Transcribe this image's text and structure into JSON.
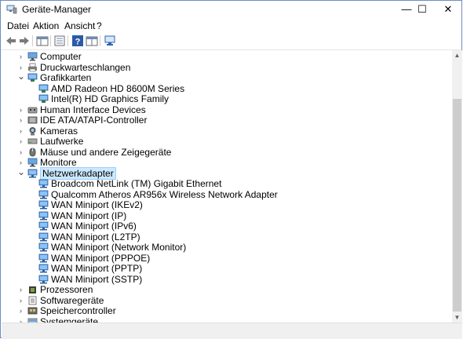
{
  "window": {
    "title": "Geräte-Manager"
  },
  "window_buttons": {
    "minimize": "—",
    "maximize": "☐",
    "close": "✕"
  },
  "menu": {
    "items": [
      "Datei",
      "Aktion",
      "Ansicht",
      "?"
    ]
  },
  "tree": {
    "items": [
      {
        "label": "Computer",
        "icon": "monitor-icon",
        "expanded": false,
        "level": 0
      },
      {
        "label": "Druckwarteschlangen",
        "icon": "printer-icon",
        "expanded": false,
        "level": 0
      },
      {
        "label": "Grafikkarten",
        "icon": "display-adapter-icon",
        "expanded": true,
        "level": 0
      },
      {
        "label": "AMD Radeon HD 8600M Series",
        "icon": "display-adapter-icon",
        "level": 1
      },
      {
        "label": "Intel(R) HD Graphics Family",
        "icon": "display-adapter-icon",
        "level": 1
      },
      {
        "label": "Human Interface Devices",
        "icon": "hid-icon",
        "expanded": false,
        "level": 0
      },
      {
        "label": "IDE ATA/ATAPI-Controller",
        "icon": "ide-controller-icon",
        "expanded": false,
        "level": 0
      },
      {
        "label": "Kameras",
        "icon": "camera-icon",
        "expanded": false,
        "level": 0
      },
      {
        "label": "Laufwerke",
        "icon": "drive-icon",
        "expanded": false,
        "level": 0
      },
      {
        "label": "Mäuse und andere Zeigegeräte",
        "icon": "mouse-icon",
        "expanded": false,
        "level": 0
      },
      {
        "label": "Monitore",
        "icon": "monitor-icon",
        "expanded": false,
        "level": 0
      },
      {
        "label": "Netzwerkadapter",
        "icon": "network-adapter-icon",
        "expanded": true,
        "selected": true,
        "level": 0
      },
      {
        "label": "Broadcom NetLink (TM) Gigabit Ethernet",
        "icon": "network-adapter-icon",
        "level": 1
      },
      {
        "label": "Qualcomm Atheros AR956x Wireless Network Adapter",
        "icon": "network-adapter-icon",
        "level": 1
      },
      {
        "label": "WAN Miniport (IKEv2)",
        "icon": "network-adapter-icon",
        "level": 1
      },
      {
        "label": "WAN Miniport (IP)",
        "icon": "network-adapter-icon",
        "level": 1
      },
      {
        "label": "WAN Miniport (IPv6)",
        "icon": "network-adapter-icon",
        "level": 1
      },
      {
        "label": "WAN Miniport (L2TP)",
        "icon": "network-adapter-icon",
        "level": 1
      },
      {
        "label": "WAN Miniport (Network Monitor)",
        "icon": "network-adapter-icon",
        "level": 1
      },
      {
        "label": "WAN Miniport (PPPOE)",
        "icon": "network-adapter-icon",
        "level": 1
      },
      {
        "label": "WAN Miniport (PPTP)",
        "icon": "network-adapter-icon",
        "level": 1
      },
      {
        "label": "WAN Miniport (SSTP)",
        "icon": "network-adapter-icon",
        "level": 1
      },
      {
        "label": "Prozessoren",
        "icon": "processor-icon",
        "expanded": false,
        "level": 0
      },
      {
        "label": "Softwaregeräte",
        "icon": "software-device-icon",
        "expanded": false,
        "level": 0
      },
      {
        "label": "Speichercontroller",
        "icon": "storage-controller-icon",
        "expanded": false,
        "level": 0
      },
      {
        "label": "Systemgeräte",
        "icon": "system-device-icon",
        "expanded": false,
        "level": 0
      }
    ]
  },
  "colors": {
    "selection_bg": "#cce8ff",
    "selection_border": "#99d1ff",
    "accent": "#0078d7"
  }
}
